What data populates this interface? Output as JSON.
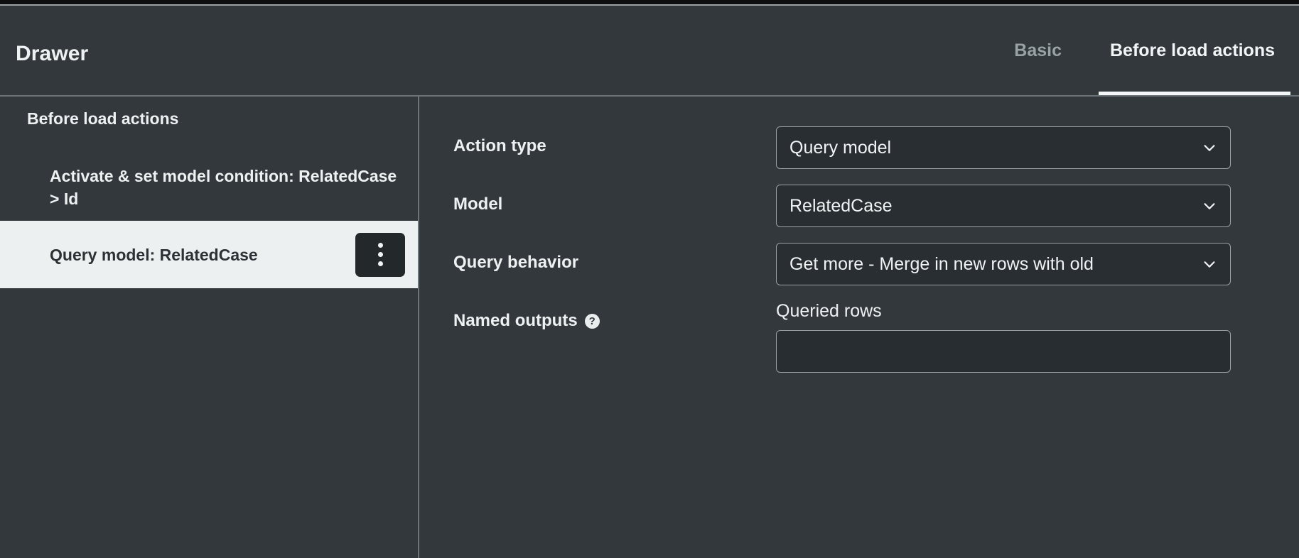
{
  "header": {
    "title": "Drawer",
    "tabs": [
      {
        "label": "Basic",
        "active": false
      },
      {
        "label": "Before load actions",
        "active": true
      }
    ]
  },
  "sidebar": {
    "heading": "Before load actions",
    "items": [
      {
        "label": "Activate & set model condition: RelatedCase > Id",
        "selected": false
      },
      {
        "label": "Query model: RelatedCase",
        "selected": true
      }
    ],
    "kebab_menu_label": "more-options"
  },
  "main": {
    "fields": [
      {
        "label": "Action type",
        "control": "select",
        "value": "Query model"
      },
      {
        "label": "Model",
        "control": "select",
        "value": "RelatedCase"
      },
      {
        "label": "Query behavior",
        "control": "select",
        "value": "Get more - Merge in new rows with old"
      }
    ],
    "named_outputs": {
      "label": "Named outputs",
      "help_glyph": "?",
      "output_name": "Queried rows",
      "output_value": "",
      "output_placeholder": ""
    }
  },
  "colors": {
    "panel_bg": "#32383b",
    "control_bg": "#282e31",
    "border": "#9aa2a7",
    "text": "#eef1f2",
    "muted_text": "#9aa2a7",
    "selected_row_bg": "#ecf0f1",
    "selected_row_text": "#2b3134",
    "kebab_bg": "#23282a"
  }
}
